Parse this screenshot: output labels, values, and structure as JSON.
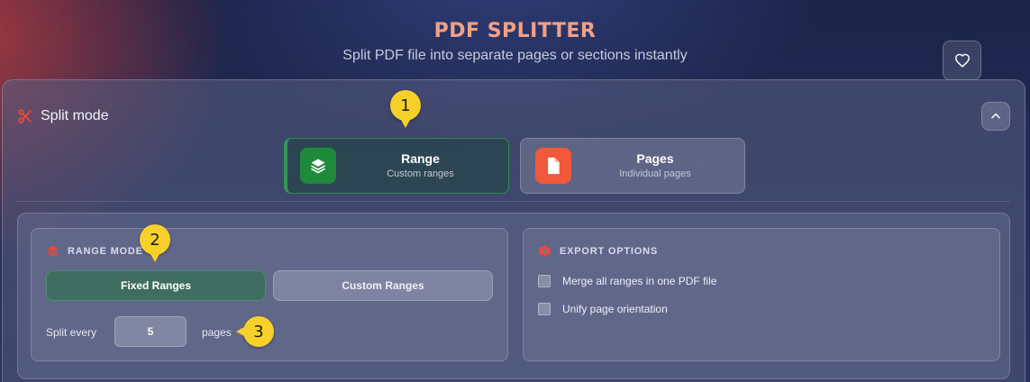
{
  "header": {
    "title": "PDF SPLITTER",
    "subtitle": "Split PDF file into separate pages or sections instantly"
  },
  "split_mode": {
    "title": "Split mode",
    "options": [
      {
        "label": "Range",
        "description": "Custom ranges",
        "icon": "layers-icon",
        "selected": true
      },
      {
        "label": "Pages",
        "description": "Individual pages",
        "icon": "file-icon",
        "selected": false
      }
    ]
  },
  "range_mode": {
    "title": "RANGE MODE",
    "fixed_label": "Fixed Ranges",
    "custom_label": "Custom Ranges",
    "selected": "Fixed Ranges",
    "split_every_label": "Split every",
    "split_every_value": "5",
    "pages_label": "pages"
  },
  "export_options": {
    "title": "EXPORT OPTIONS",
    "options": [
      {
        "label": "Merge all ranges in one PDF file",
        "checked": false
      },
      {
        "label": "Unify page orientation",
        "checked": false
      }
    ]
  },
  "annotations": [
    "1",
    "2",
    "3"
  ],
  "colors": {
    "title": "#f4a084",
    "range_icon_bg": "#1f8a3c",
    "pages_icon_bg": "#f2583b",
    "fixed_button_bg": "#3f6e60",
    "badge": "#f7d02a",
    "accent_red": "#ef4a3c"
  }
}
